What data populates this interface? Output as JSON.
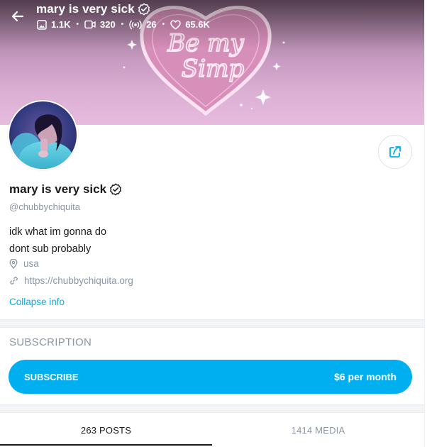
{
  "header": {
    "name": "mary is very sick",
    "stats": {
      "photos": "1.1K",
      "videos": "320",
      "streams": "26",
      "likes": "65.6K"
    }
  },
  "cover": {
    "line1": "Be my",
    "line2": "Simp"
  },
  "profile": {
    "name": "mary is very sick",
    "username": "@chubbychiquita",
    "bio_line1": "idk what im gonna do",
    "bio_line2": "dont sub probably",
    "location": "usa",
    "website": "https://chubbychiquita.org",
    "collapse_label": "Collapse info"
  },
  "subscription": {
    "heading": "SUBSCRIPTION",
    "button_label": "SUBSCRIBE",
    "price": "$6 per month"
  },
  "tabs": [
    {
      "label": "263 POSTS",
      "active": true
    },
    {
      "label": "1414 MEDIA",
      "active": false
    }
  ],
  "colors": {
    "accent": "#00aff0",
    "muted": "#8a96a3",
    "text": "#1a1a1a"
  },
  "icons": [
    "back-arrow-icon",
    "verified-icon",
    "photo-icon",
    "video-icon",
    "stream-icon",
    "heart-icon",
    "share-icon",
    "location-icon",
    "link-icon"
  ]
}
